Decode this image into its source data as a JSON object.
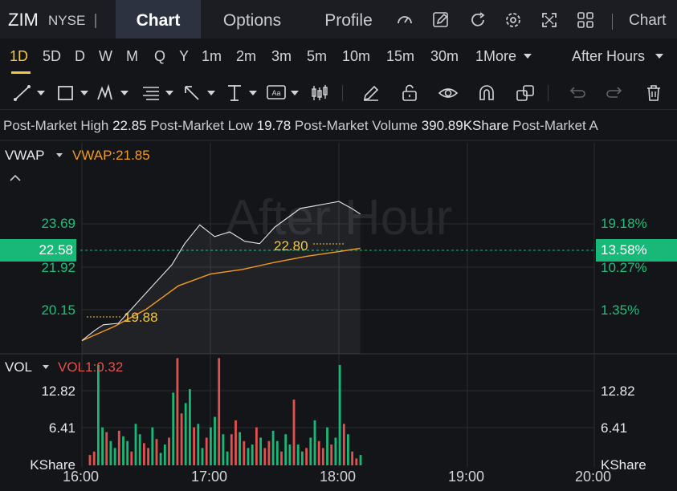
{
  "header": {
    "symbol": "ZIM",
    "exchange": "NYSE",
    "tabs": [
      {
        "label": "Chart",
        "active": true
      },
      {
        "label": "Options",
        "active": false
      },
      {
        "label": "Profile",
        "active": false
      }
    ],
    "icons": [
      "gauge-icon",
      "edit-icon",
      "refresh-icon",
      "settings-icon",
      "fullscreen-icon",
      "grid-icon"
    ],
    "right_label": "Chart"
  },
  "periods": {
    "items": [
      "1D",
      "5D",
      "D",
      "W",
      "M",
      "Q",
      "Y",
      "1m",
      "2m",
      "3m",
      "5m",
      "10m",
      "15m",
      "30m"
    ],
    "more_label": "1More",
    "selected": "1D",
    "session_label": "After Hours"
  },
  "drawing_tools": [
    "trendline-icon",
    "rectangle-icon",
    "pattern-icon",
    "fibonacci-icon",
    "arrow-icon",
    "measure-icon",
    "text-icon",
    "candle-icon",
    "pencil-icon",
    "unlock-icon",
    "eye-icon",
    "magnet-icon",
    "layers-icon",
    "undo-icon",
    "redo-icon",
    "trash-icon"
  ],
  "stats": {
    "high_label": "Post-Market High",
    "high_value": "22.85",
    "low_label": "Post-Market Low",
    "low_value": "19.78",
    "volume_label": "Post-Market Volume",
    "volume_value": "390.89KShare",
    "trailing_label": "Post-Market A"
  },
  "price_panel": {
    "indicator_name": "VWAP",
    "indicator_value": "VWAP:21.85",
    "watermark": "After Hour",
    "left_axis": [
      "23.69",
      "21.92",
      "20.15"
    ],
    "right_axis": [
      "19.18%",
      "10.27%",
      "1.35%"
    ],
    "current_price": "22.58",
    "current_pct": "13.58%",
    "high_marker": "22.80",
    "low_marker": "19.88"
  },
  "volume_panel": {
    "indicator_name": "VOL",
    "indicator_value": "VOL1:0.32",
    "left_axis": [
      "12.82",
      "6.41",
      "KShare"
    ],
    "right_axis": [
      "12.82",
      "6.41",
      "KShare"
    ]
  },
  "time_axis": [
    "16:00",
    "17:00",
    "18:00",
    "19:00",
    "20:00"
  ],
  "colors": {
    "accent": "#f3c845",
    "up": "#18b978",
    "down": "#e0514f",
    "vwap": "#f39c1f",
    "price_line": "#e8e8e8"
  },
  "chart_data": [
    {
      "type": "line",
      "title": "",
      "x_range": [
        "16:00",
        "20:00"
      ],
      "ylim": [
        19.6,
        24.1
      ],
      "series": [
        {
          "name": "",
          "x": [
            "16:00",
            "16:06",
            "16:10",
            "16:17",
            "16:24",
            "16:30",
            "16:36",
            "16:42",
            "16:48",
            "16:55",
            "17:02",
            "17:09",
            "17:16",
            "17:23",
            "17:30",
            "17:36",
            "17:42",
            "17:48",
            "17:54",
            "18:00",
            "18:06",
            "18:10"
          ],
          "values": [
            19.88,
            20.1,
            20.22,
            20.25,
            20.6,
            20.9,
            21.2,
            21.5,
            21.95,
            22.35,
            22.1,
            22.2,
            22.0,
            21.95,
            22.3,
            22.5,
            22.7,
            22.75,
            22.8,
            22.85,
            22.7,
            22.58
          ]
        },
        {
          "name": "VWAP",
          "x": [
            "16:00",
            "16:06",
            "16:15",
            "16:30",
            "16:45",
            "17:00",
            "17:15",
            "17:30",
            "17:45",
            "18:00",
            "18:10"
          ],
          "values": [
            19.88,
            20.0,
            20.18,
            20.55,
            21.05,
            21.3,
            21.4,
            21.55,
            21.68,
            21.78,
            21.85
          ]
        }
      ],
      "xlabel": "",
      "ylabel": ""
    },
    {
      "type": "bar",
      "title": "",
      "ylim": [
        0,
        16
      ],
      "series": [
        {
          "name": "",
          "values": [
            1.5,
            2.0,
            14.5,
            5.5,
            4.8,
            3.5,
            2.5,
            5.0,
            4.2,
            3.5,
            2.0,
            6.0,
            4.5,
            3.2,
            2.5,
            5.5,
            3.8,
            1.8,
            3.0,
            4.0,
            10.5,
            15.5,
            7.5,
            9.0,
            11.0,
            5.5,
            6.0,
            2.5,
            4.0,
            5.5,
            7.0,
            15.5,
            4.5,
            2.0,
            4.5,
            6.5,
            4.8,
            3.5,
            2.5,
            3.0,
            5.5,
            4.0,
            2.5,
            3.5,
            5.0,
            3.5,
            2.0,
            4.5,
            3.0,
            9.5,
            3.0,
            2.0,
            2.5,
            4.0,
            6.5,
            3.5,
            2.5,
            5.5,
            3.0,
            4.0,
            14.5,
            6.0,
            4.5,
            2.0,
            1.0,
            1.5
          ]
        }
      ]
    }
  ]
}
